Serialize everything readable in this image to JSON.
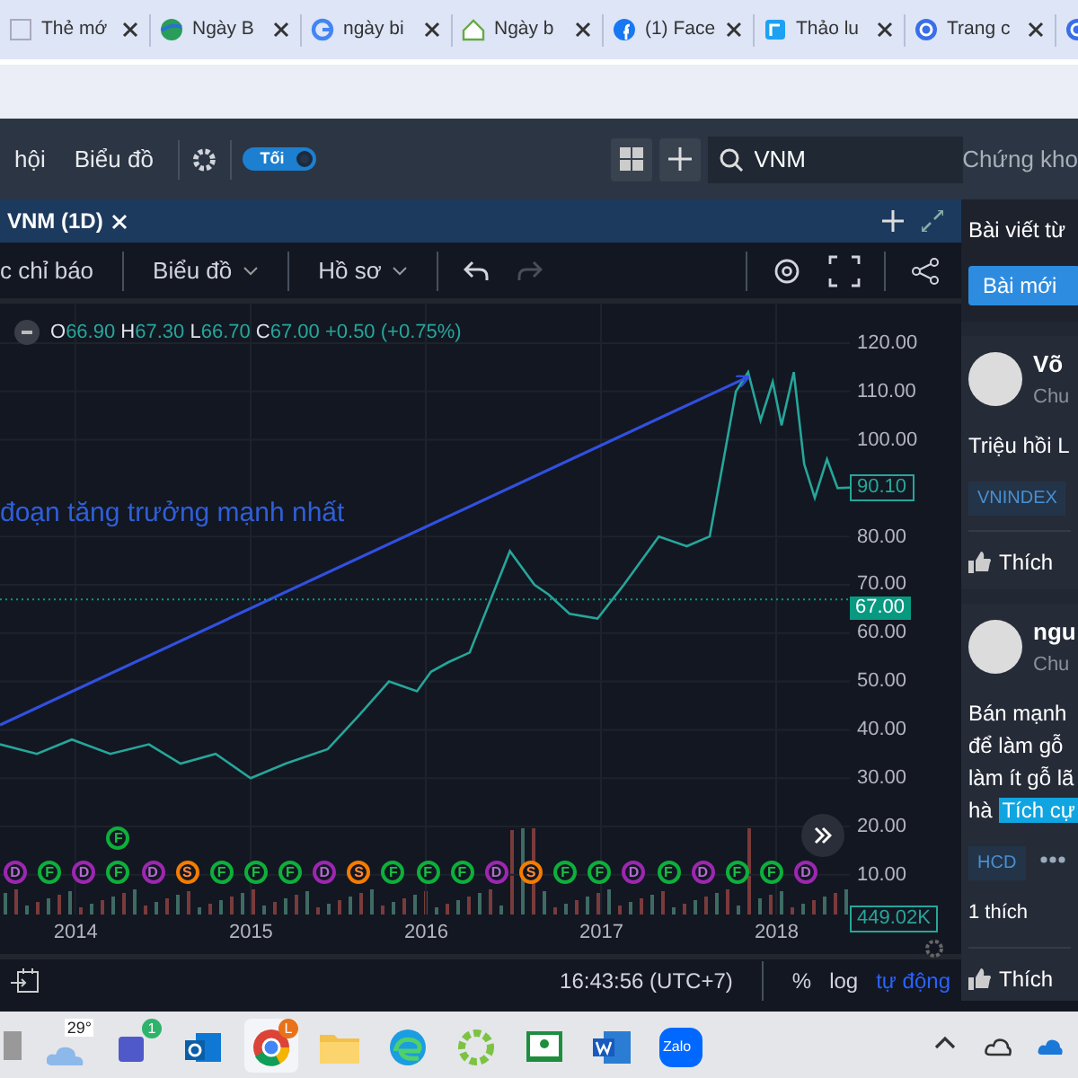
{
  "browser_tabs": [
    {
      "title": "Thẻ mớ"
    },
    {
      "title": "Ngày B"
    },
    {
      "title": "ngày bi"
    },
    {
      "title": "Ngày b"
    },
    {
      "title": "(1) Face"
    },
    {
      "title": "Thảo lu"
    },
    {
      "title": "Trang c"
    }
  ],
  "toolbar": {
    "links": [
      "hội",
      "Biểu đồ"
    ],
    "theme_toggle": {
      "label": "Tối",
      "on": true
    },
    "search": {
      "value": "VNM"
    },
    "market_label": "Chứng kho"
  },
  "chart_tab": {
    "title": "VNM (1D)"
  },
  "chart_toolbar": {
    "items": [
      {
        "label": "c chỉ báo",
        "dropdown": false
      },
      {
        "label": "Biểu đồ",
        "dropdown": true
      },
      {
        "label": "Hồ sơ",
        "dropdown": true
      }
    ],
    "history": [
      {
        "kind": "undo",
        "disabled": false
      },
      {
        "kind": "redo",
        "disabled": true
      }
    ]
  },
  "legend": [
    {
      "label": "O",
      "value": "66.90"
    },
    {
      "label": "H",
      "value": "67.30"
    },
    {
      "label": "L",
      "value": "66.70"
    },
    {
      "label": "C",
      "value": "67.00"
    },
    {
      "value": "+0.50 (+0.75%)"
    }
  ],
  "annotation_text": "đoạn tăng trưởng mạnh nhất",
  "chart_data": {
    "type": "line",
    "grid": true,
    "xlim": [
      2013.57,
      2018.42
    ],
    "ylim": [
      1.78,
      128.18
    ],
    "ref_lines": [
      {
        "axis": "y",
        "value": 67,
        "color": "#089981"
      }
    ],
    "xticks": [
      {
        "value": 2014,
        "label": "2014"
      },
      {
        "value": 2015,
        "label": "2015"
      },
      {
        "value": 2016,
        "label": "2016"
      },
      {
        "value": 2017,
        "label": "2017"
      },
      {
        "value": 2018,
        "label": "2018"
      }
    ],
    "yticks": [
      {
        "value": 120,
        "label": "120.00"
      },
      {
        "value": 110,
        "label": "110.00"
      },
      {
        "value": 100,
        "label": "100.00"
      },
      {
        "value": 80,
        "label": "80.00"
      },
      {
        "value": 70,
        "label": "70.00"
      },
      {
        "value": 60,
        "label": "60.00"
      },
      {
        "value": 50,
        "label": "50.00"
      },
      {
        "value": 40,
        "label": "40.00"
      },
      {
        "value": 30,
        "label": "30.00"
      },
      {
        "value": 20,
        "label": "20.00"
      },
      {
        "value": 10,
        "label": "10.00"
      }
    ],
    "x": [
      2013.57,
      2013.78,
      2013.98,
      2014.2,
      2014.42,
      2014.6,
      2014.8,
      2015.0,
      2015.2,
      2015.44,
      2015.62,
      2015.79,
      2015.95,
      2016.03,
      2016.13,
      2016.25,
      2016.48,
      2016.62,
      2016.7,
      2016.82,
      2016.98,
      2017.13,
      2017.33,
      2017.49,
      2017.62,
      2017.77,
      2017.84,
      2017.91,
      2017.98,
      2018.03,
      2018.1,
      2018.16,
      2018.22,
      2018.29,
      2018.35,
      2018.42
    ],
    "series": [
      {
        "color": "#26a69a",
        "values": [
          37,
          35,
          38,
          35,
          37,
          33,
          35,
          30,
          33,
          36,
          43,
          50,
          48,
          52,
          54,
          56,
          77,
          70,
          68,
          64,
          63,
          70,
          80,
          78,
          80,
          110,
          114,
          104,
          112,
          103,
          114,
          95,
          88,
          96,
          90,
          90.1
        ]
      },
      {
        "color": "#3150e0",
        "values": [
          41,
          null,
          null,
          null,
          null,
          null,
          null,
          null,
          null,
          null,
          null,
          null,
          null,
          null,
          null,
          null,
          null,
          null,
          null,
          null,
          null,
          null,
          null,
          null,
          null,
          null,
          113,
          null,
          null,
          null,
          null,
          null,
          null,
          null,
          null,
          null
        ]
      }
    ]
  },
  "price_tags": [
    {
      "kind": "outline",
      "text": "90.10"
    },
    {
      "kind": "filled",
      "text": "67.00"
    },
    {
      "kind": "volume",
      "text": "449.02K"
    }
  ],
  "events": [
    {
      "kind": "D"
    },
    {
      "kind": "F"
    },
    {
      "kind": "D"
    },
    {
      "kind": "F",
      "stack": [
        {
          "kind": "F"
        }
      ]
    },
    {
      "kind": "D"
    },
    {
      "kind": "S"
    },
    {
      "kind": "F"
    },
    {
      "kind": "F"
    },
    {
      "kind": "F"
    },
    {
      "kind": "D"
    },
    {
      "kind": "S"
    },
    {
      "kind": "F"
    },
    {
      "kind": "F"
    },
    {
      "kind": "F"
    },
    {
      "kind": "D"
    },
    {
      "kind": "S"
    },
    {
      "kind": "F"
    },
    {
      "kind": "F"
    },
    {
      "kind": "D"
    },
    {
      "kind": "F"
    },
    {
      "kind": "D"
    },
    {
      "kind": "F"
    },
    {
      "kind": "F"
    },
    {
      "kind": "D"
    }
  ],
  "bottom_bar": {
    "time": "16:43:56 (UTC+7)",
    "scales": [
      {
        "label": "%",
        "selected": false
      },
      {
        "label": "log",
        "selected": false
      },
      {
        "label": "tự động",
        "selected": true
      }
    ]
  },
  "side_panel": {
    "title": "Bài viết từ",
    "new_button": "Bài mới",
    "posts": [
      {
        "author": "Võ",
        "subtitle": "Chu",
        "body": "Triệu hồi L",
        "tags": [
          "VNINDEX"
        ],
        "more": false,
        "like_button": "Thích"
      },
      {
        "author": "ngu",
        "subtitle": "Chu",
        "body": "Bán mạnh\nđể làm gỗ\nlàm ít gỗ lã\nhà",
        "highlight": "Tích cự",
        "tags": [
          "HCD"
        ],
        "more": true,
        "likes": "1 thích",
        "like_button": "Thích"
      }
    ]
  },
  "taskbar": [
    {
      "kind": "partial",
      "active": false
    },
    {
      "kind": "weather",
      "text": "29°",
      "active": false
    },
    {
      "kind": "teams",
      "text": "1",
      "active": false
    },
    {
      "kind": "outlook",
      "active": false
    },
    {
      "kind": "chrome",
      "text": "L",
      "active": true
    },
    {
      "kind": "folder",
      "active": false
    },
    {
      "kind": "edge",
      "active": false
    },
    {
      "kind": "lime",
      "active": false
    },
    {
      "kind": "classroom",
      "active": false
    },
    {
      "kind": "word",
      "active": false
    },
    {
      "kind": "zalo",
      "text": "Zalo",
      "active": false
    }
  ]
}
